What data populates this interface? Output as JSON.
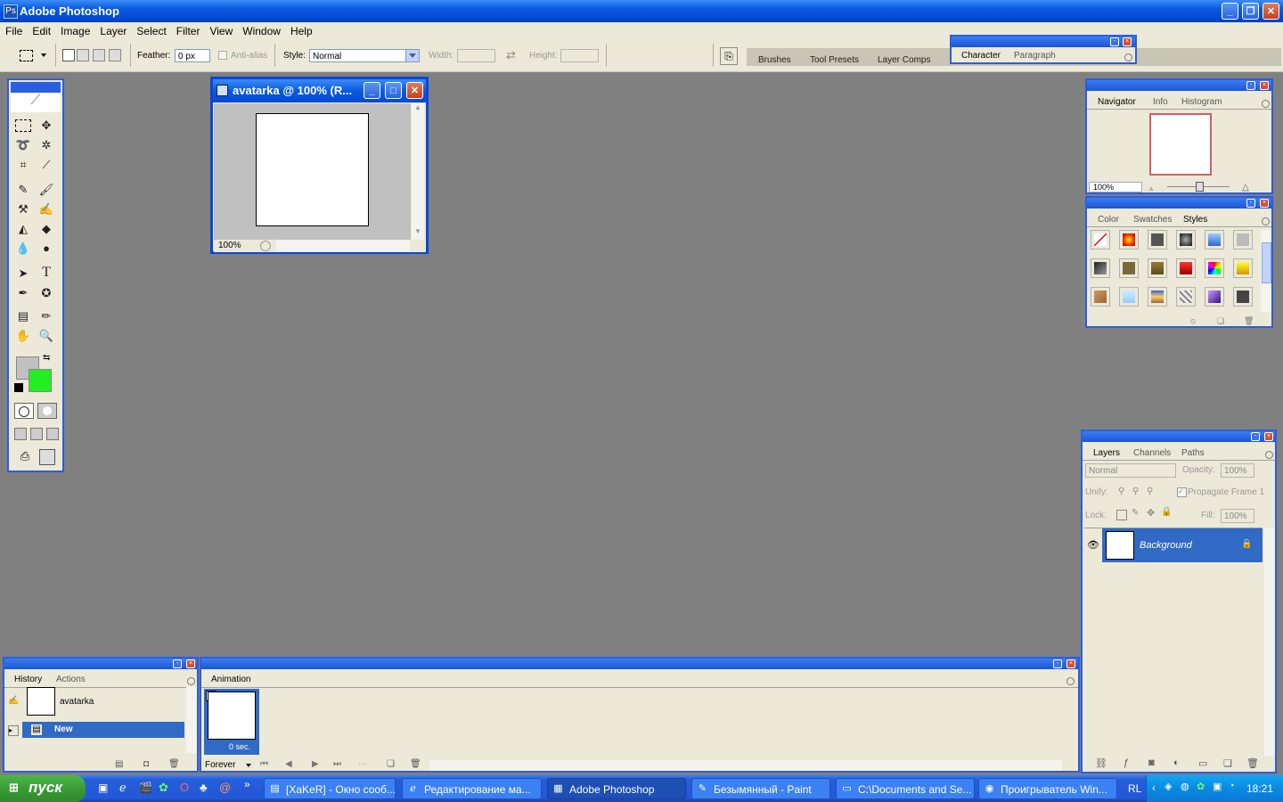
{
  "window": {
    "title": "Adobe Photoshop"
  },
  "menu": [
    "File",
    "Edit",
    "Image",
    "Layer",
    "Select",
    "Filter",
    "View",
    "Window",
    "Help"
  ],
  "options": {
    "feather_label": "Feather:",
    "feather_value": "0 px",
    "antialias_label": "Anti-alias",
    "style_label": "Style:",
    "style_value": "Normal",
    "width_label": "Width:",
    "height_label": "Height:"
  },
  "palette_well": {
    "tabs": [
      "Brushes",
      "Tool Presets",
      "Layer Comps"
    ]
  },
  "character_palette": {
    "tabs": [
      "Character",
      "Paragraph"
    ]
  },
  "document": {
    "title": "avatarka @ 100% (R...",
    "zoom": "100%"
  },
  "navigator": {
    "tabs": [
      "Navigator",
      "Info",
      "Histogram"
    ],
    "zoom": "100%"
  },
  "color_palette": {
    "tabs": [
      "Color",
      "Swatches",
      "Styles"
    ]
  },
  "layers": {
    "tabs": [
      "Layers",
      "Channels",
      "Paths"
    ],
    "blend_mode": "Normal",
    "opacity_label": "Opacity:",
    "opacity_value": "100%",
    "unify_label": "Unify:",
    "propagate_label": "Propagate Frame 1",
    "lock_label": "Lock:",
    "fill_label": "Fill:",
    "fill_value": "100%",
    "items": [
      {
        "name": "Background"
      }
    ]
  },
  "history": {
    "tabs": [
      "History",
      "Actions"
    ],
    "snapshot": "avatarka",
    "items": [
      {
        "name": "New"
      }
    ]
  },
  "animation": {
    "tab": "Animation",
    "frame_number": "1",
    "frame_delay": "0 sec.",
    "loop": "Forever"
  },
  "taskbar": {
    "start": "пуск",
    "tasks": [
      {
        "label": "[XaKeR] - Окно сооб..."
      },
      {
        "label": "Редактирование ма..."
      },
      {
        "label": "Adobe Photoshop"
      },
      {
        "label": "Безымянный - Paint"
      },
      {
        "label": "C:\\Documents and Se..."
      },
      {
        "label": "Проигрыватель Win..."
      }
    ],
    "lang": "RL",
    "clock": "18:21"
  },
  "colors": {
    "foreground": "#c0c0c0",
    "background": "#22ee22",
    "selection": "#316ac5"
  }
}
